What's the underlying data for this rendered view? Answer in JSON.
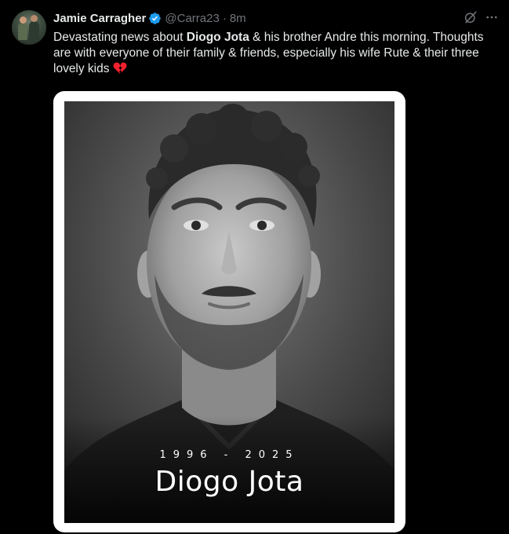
{
  "author": {
    "name": "Jamie Carragher",
    "handle": "@Carra23",
    "separator": "·",
    "time": "8m",
    "verified": true
  },
  "tweet": {
    "text_before": "Devastating news about ",
    "bold_mention": "Diogo Jota",
    "text_after": " & his brother Andre this morning. Thoughts are with everyone of their family & friends, especially his wife Rute & their three lovely kids",
    "emoji": "broken-heart"
  },
  "media": {
    "years": "1996 - 2025",
    "name": "Diogo Jota"
  },
  "icons": {
    "grok": "grok-icon",
    "more": "more-icon",
    "verified": "verified-badge-icon"
  },
  "colors": {
    "background": "#000000",
    "text": "#e7e9ea",
    "muted": "#71767b",
    "verified": "#1d9bf0",
    "heart": "#f4212e"
  }
}
